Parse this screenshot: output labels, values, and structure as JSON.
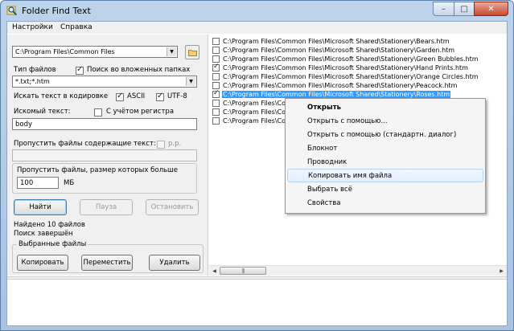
{
  "window": {
    "title": "Folder Find Text",
    "controls": {
      "minimize": "–",
      "maximize": "□",
      "close": "✕"
    }
  },
  "menu": {
    "items": [
      "Настройки",
      "Справка"
    ]
  },
  "search": {
    "folder_value": "C:\\Program Files\\Common Files",
    "file_types_label": "Тип файлов",
    "subfolders_label": "Поиск во вложенных папках",
    "subfolders_checked": true,
    "file_types_value": "*.txt;*.htm",
    "encoding_label": "Искать текст в кодировке",
    "ascii_label": "ASCII",
    "ascii_checked": true,
    "utf8_label": "UTF-8",
    "utf8_checked": true,
    "search_text_label": "Искомый текст:",
    "case_label": "С учётом регистра",
    "case_checked": false,
    "search_text_value": "body",
    "skip_text_label": "Пропустить файлы содержащие текст:",
    "skip_case_label": "р.р.",
    "skip_text_value": "",
    "skip_size_label": "Пропустить файлы, размер которых больше",
    "skip_size_value": "100",
    "size_unit": "МБ"
  },
  "actions": {
    "find": "Найти",
    "pause": "Пауза",
    "stop": "Остановить"
  },
  "status": {
    "found": "Найдено 10 файлов",
    "done": "Поиск завершён"
  },
  "selected_files": {
    "label": "Выбранные файлы",
    "copy": "Копировать",
    "move": "Переместить",
    "delete": "Удалить"
  },
  "results": [
    {
      "path": "C:\\Program Files\\Common Files\\Microsoft Shared\\Stationery\\Bears.htm",
      "checked": false,
      "selected": false
    },
    {
      "path": "C:\\Program Files\\Common Files\\Microsoft Shared\\Stationery\\Garden.htm",
      "checked": false,
      "selected": false
    },
    {
      "path": "C:\\Program Files\\Common Files\\Microsoft Shared\\Stationery\\Green Bubbles.htm",
      "checked": false,
      "selected": false
    },
    {
      "path": "C:\\Program Files\\Common Files\\Microsoft Shared\\Stationery\\Hand Prints.htm",
      "checked": true,
      "selected": false
    },
    {
      "path": "C:\\Program Files\\Common Files\\Microsoft Shared\\Stationery\\Orange Circles.htm",
      "checked": false,
      "selected": false
    },
    {
      "path": "C:\\Program Files\\Common Files\\Microsoft Shared\\Stationery\\Peacock.htm",
      "checked": false,
      "selected": false
    },
    {
      "path": "C:\\Program Files\\Common Files\\Microsoft Shared\\Stationery\\Roses.htm",
      "checked": true,
      "selected": true
    },
    {
      "path": "C:\\Program Files\\Commo",
      "checked": false,
      "selected": false
    },
    {
      "path": "C:\\Program Files\\Commo",
      "checked": false,
      "selected": false
    },
    {
      "path": "C:\\Program Files\\Commo",
      "checked": false,
      "selected": false
    }
  ],
  "scroll": {
    "thumb_grip": "|||"
  },
  "context_menu": {
    "items": [
      "Открыть",
      "Открыть с помощью...",
      "Открыть с помощью (стандартн. диалог)",
      "Блокнот",
      "Проводник",
      "Копировать имя файла",
      "Выбрать всё",
      "Свойства"
    ],
    "bold_index": 0,
    "highlight_index": 5
  },
  "colors": {
    "selection": "#3399ff",
    "title_gradient": "#bcd3ea",
    "close_button": "#c9462c"
  }
}
